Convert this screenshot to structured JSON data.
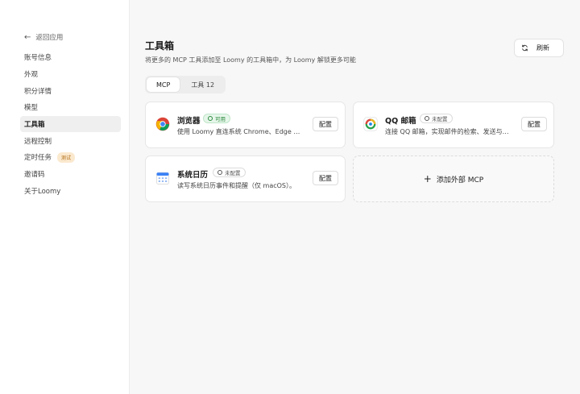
{
  "sidebar": {
    "back_label": "返回应用",
    "items": [
      {
        "label": "账号信息"
      },
      {
        "label": "外观"
      },
      {
        "label": "积分详情"
      },
      {
        "label": "模型"
      },
      {
        "label": "工具箱",
        "active": true
      },
      {
        "label": "远程控制"
      },
      {
        "label": "定时任务",
        "badge": "测试"
      },
      {
        "label": "邀请码"
      },
      {
        "label": "关于Loomy"
      }
    ]
  },
  "header": {
    "title": "工具箱",
    "subtitle": "将更多的 MCP 工具添加至 Loomy 的工具箱中，为 Loomy 解锁更多可能",
    "refresh_label": "刷新"
  },
  "tabs": [
    {
      "label": "MCP",
      "active": true
    },
    {
      "label": "工具 12"
    }
  ],
  "cards": [
    {
      "name": "浏览器",
      "status": "可用",
      "status_type": "ok",
      "desc": "使用 Loomy 直连系统 Chrome、Edge 适…",
      "config_label": "配置",
      "icon": "chrome-icon"
    },
    {
      "name": "QQ 邮箱",
      "status": "未配置",
      "status_type": "off",
      "desc": "连接 QQ 邮箱，实现邮件的检索、发送与…",
      "config_label": "配置",
      "icon": "qq-mail-icon"
    },
    {
      "name": "系统日历",
      "status": "未配置",
      "status_type": "off",
      "desc": "读写系统日历事件和提醒（仅 macOS）。",
      "config_label": "配置",
      "icon": "calendar-icon"
    }
  ],
  "add_card": {
    "label": "添加外部 MCP"
  },
  "colors": {
    "ok": "#2b8a3e",
    "beta_badge": "#b06a12"
  }
}
